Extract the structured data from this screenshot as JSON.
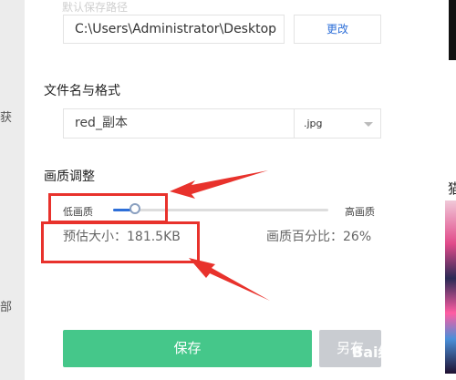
{
  "sidebar_fragments": [
    "获",
    "部"
  ],
  "right_fragment": "猫",
  "save_path": {
    "label": "默认保存路径",
    "value": "C:\\Users\\Administrator\\Desktop",
    "change_label": "更改"
  },
  "file_name": {
    "label": "文件名与格式",
    "value": "red_副本",
    "format": ".jpg"
  },
  "quality": {
    "label": "画质调整",
    "low_label": "低画质",
    "high_label": "高画质",
    "level_fraction": 0.1,
    "estimated_size": "预估大小：181.5KB",
    "percent_text": "画质百分比：26%"
  },
  "buttons": {
    "save": "保存",
    "save_as": "另存"
  },
  "watermark": "Bai经验",
  "colors": {
    "accent": "#2e6fd8",
    "save_green": "#45c78a",
    "annotation_red": "#e8322c"
  }
}
